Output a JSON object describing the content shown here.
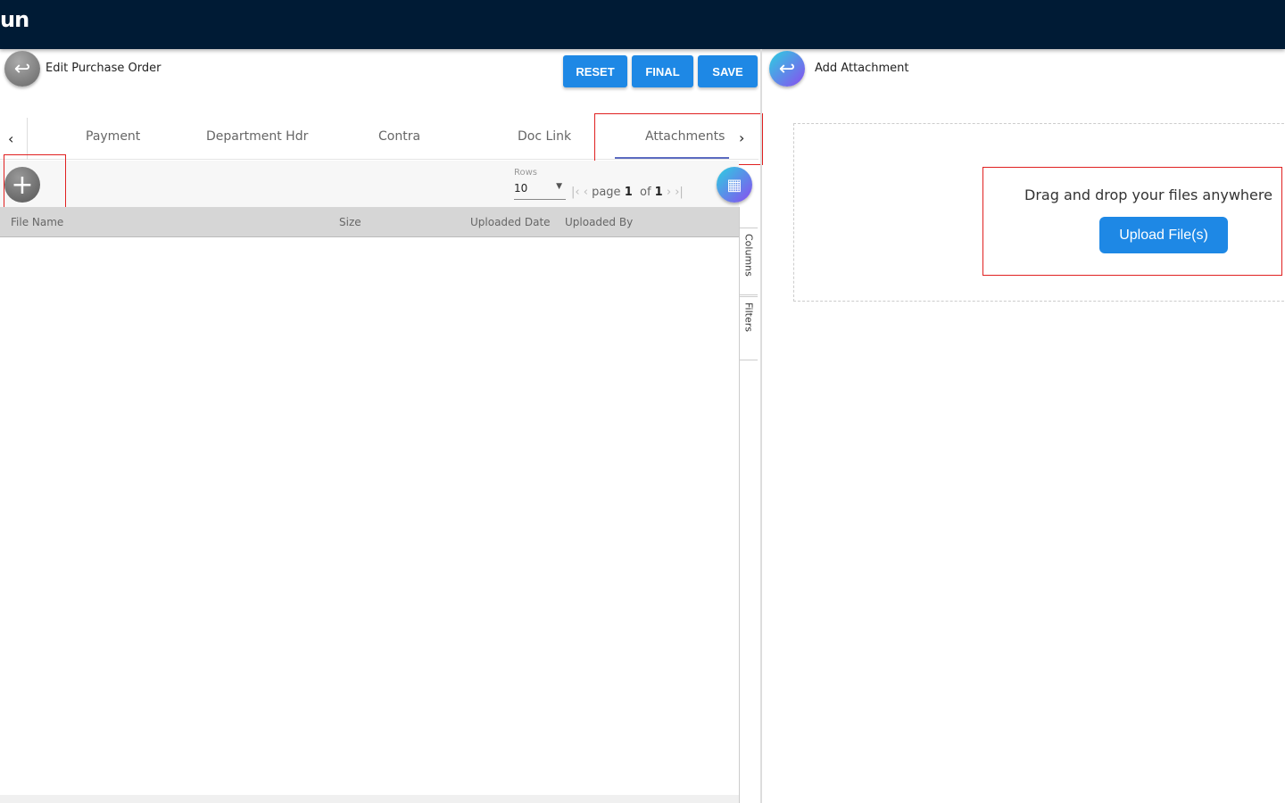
{
  "app": {
    "logo": "un"
  },
  "left": {
    "title": "Edit Purchase Order",
    "buttons": {
      "reset": "RESET",
      "final": "FINAL",
      "save": "SAVE"
    },
    "tabs": [
      "Payment",
      "Department Hdr",
      "Contra",
      "Doc Link",
      "Attachments"
    ],
    "active_tab": "Attachments",
    "pager": {
      "rows_label": "Rows",
      "rows_value": "10",
      "page_label": "page",
      "page": "1",
      "of_label": "of",
      "total": "1"
    },
    "columns": [
      "File Name",
      "Size",
      "Uploaded Date",
      "Uploaded By"
    ],
    "side_panels": {
      "columns": "Columns",
      "filters": "Filters"
    }
  },
  "right": {
    "title": "Add Attachment",
    "drop_text": "Drag and drop your files anywhere",
    "upload_label": "Upload File(s)"
  },
  "colors": {
    "topbar": "#001b35",
    "accent": "#1e88e5",
    "highlight": "#e02020"
  }
}
